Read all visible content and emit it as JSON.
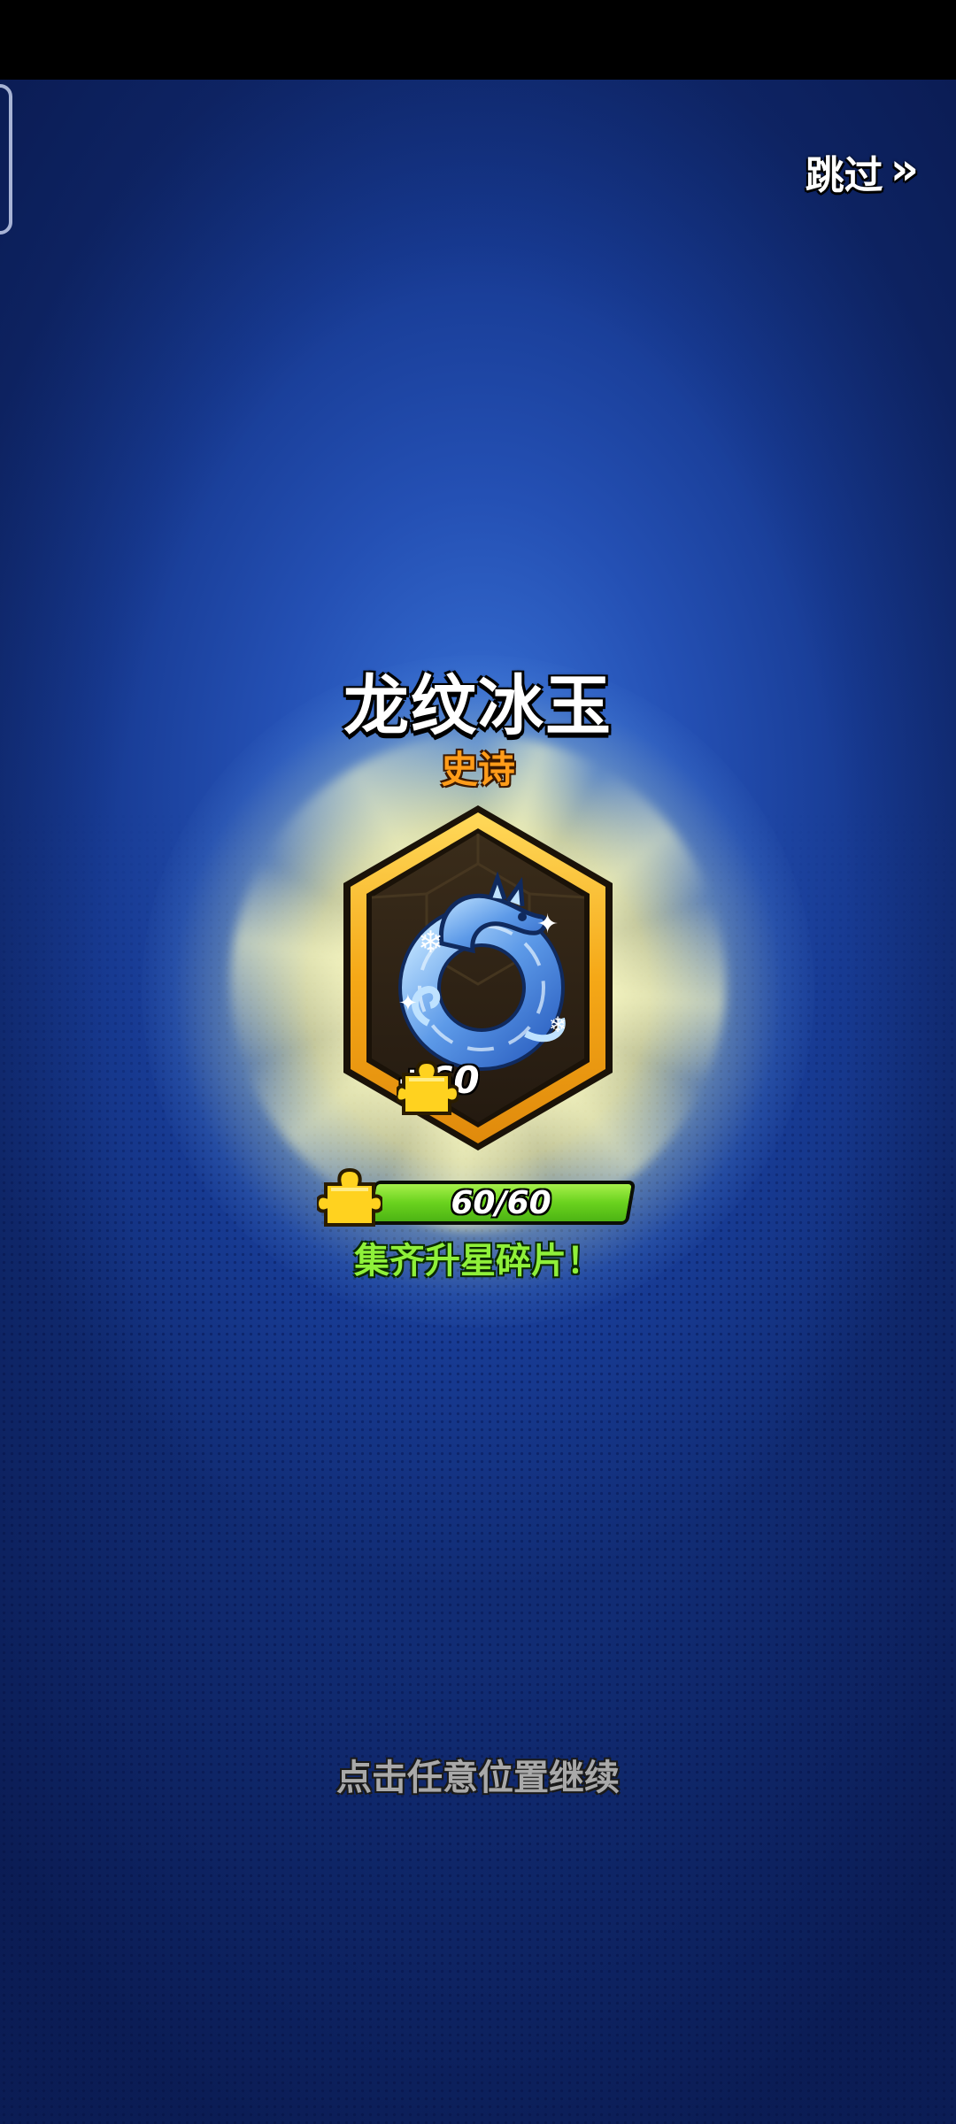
{
  "header": {
    "skip_label": "跳过",
    "skip_chevron": "»"
  },
  "reward": {
    "name": "龙纹冰玉",
    "rarity": "史诗",
    "item_icon": "ice-dragon-jade-icon",
    "shard_gain": "+60"
  },
  "progress": {
    "text": "60/60",
    "fraction": 1.0,
    "status": "集齐升星碎片！"
  },
  "footer": {
    "continue_hint": "点击任意位置继续"
  },
  "colors": {
    "rarity": "#ff9c1a",
    "progress_fill": "#6ad21e",
    "card_frame": "#f5b31a",
    "background": "#2450b4"
  }
}
